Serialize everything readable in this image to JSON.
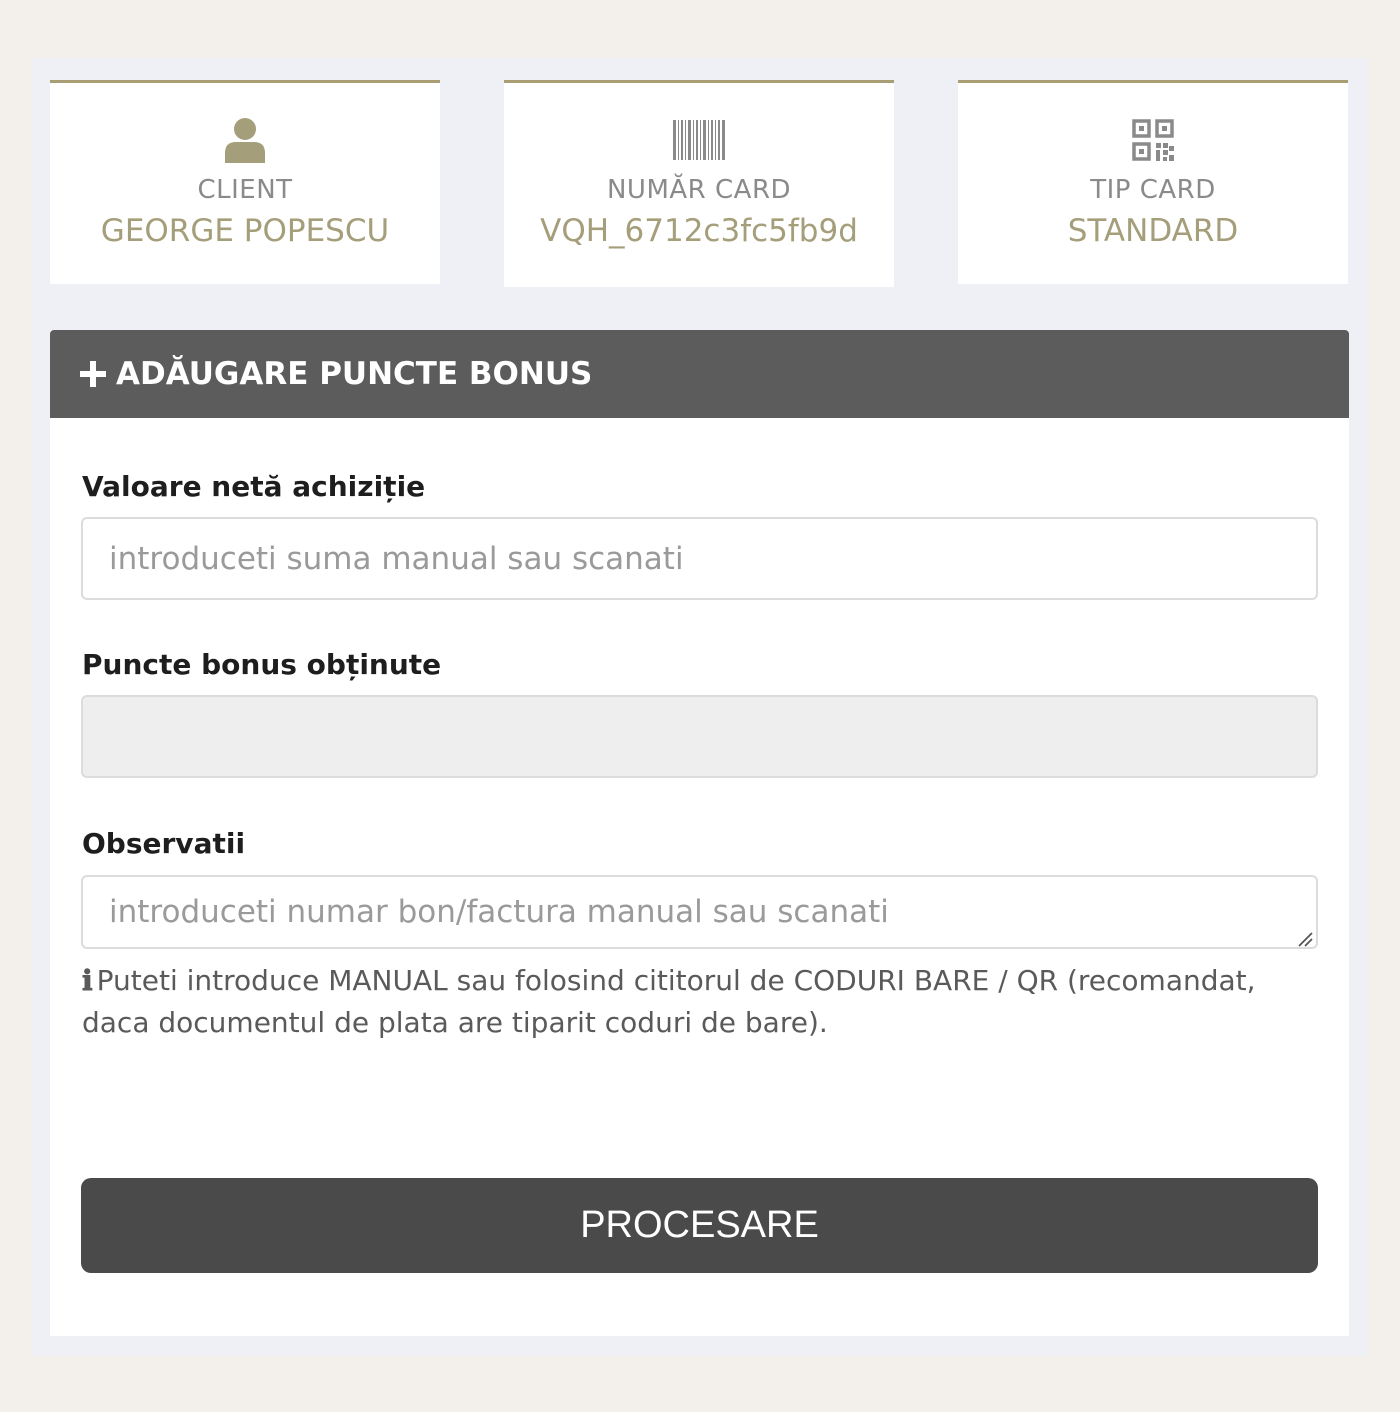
{
  "cards": [
    {
      "icon": "user-icon",
      "label": "CLIENT",
      "value": "GEORGE POPESCU"
    },
    {
      "icon": "barcode-icon",
      "label": "NUMĂR CARD",
      "value": "VQH_6712c3fc5fb9d"
    },
    {
      "icon": "qrcode-icon",
      "label": "TIP CARD",
      "value": "STANDARD"
    }
  ],
  "panel": {
    "title": "ADĂUGARE PUNCTE BONUS",
    "fields": {
      "net_value": {
        "label": "Valoare netă achiziție",
        "placeholder": "introduceti suma manual sau scanati",
        "value": ""
      },
      "bonus_points": {
        "label": "Puncte bonus obținute",
        "value": ""
      },
      "observations": {
        "label": "Observatii",
        "placeholder": "introduceti numar bon/factura manual sau scanati",
        "value": ""
      }
    },
    "help_text": "Puteti introduce MANUAL sau folosind cititorul de CODURI BARE / QR (recomandat, daca documentul de plata are tiparit coduri de bare).",
    "submit_label": "PROCESARE"
  },
  "colors": {
    "accent": "#a99d73",
    "header_bg": "#5c5c5c",
    "button_bg": "#4a4a4a"
  }
}
